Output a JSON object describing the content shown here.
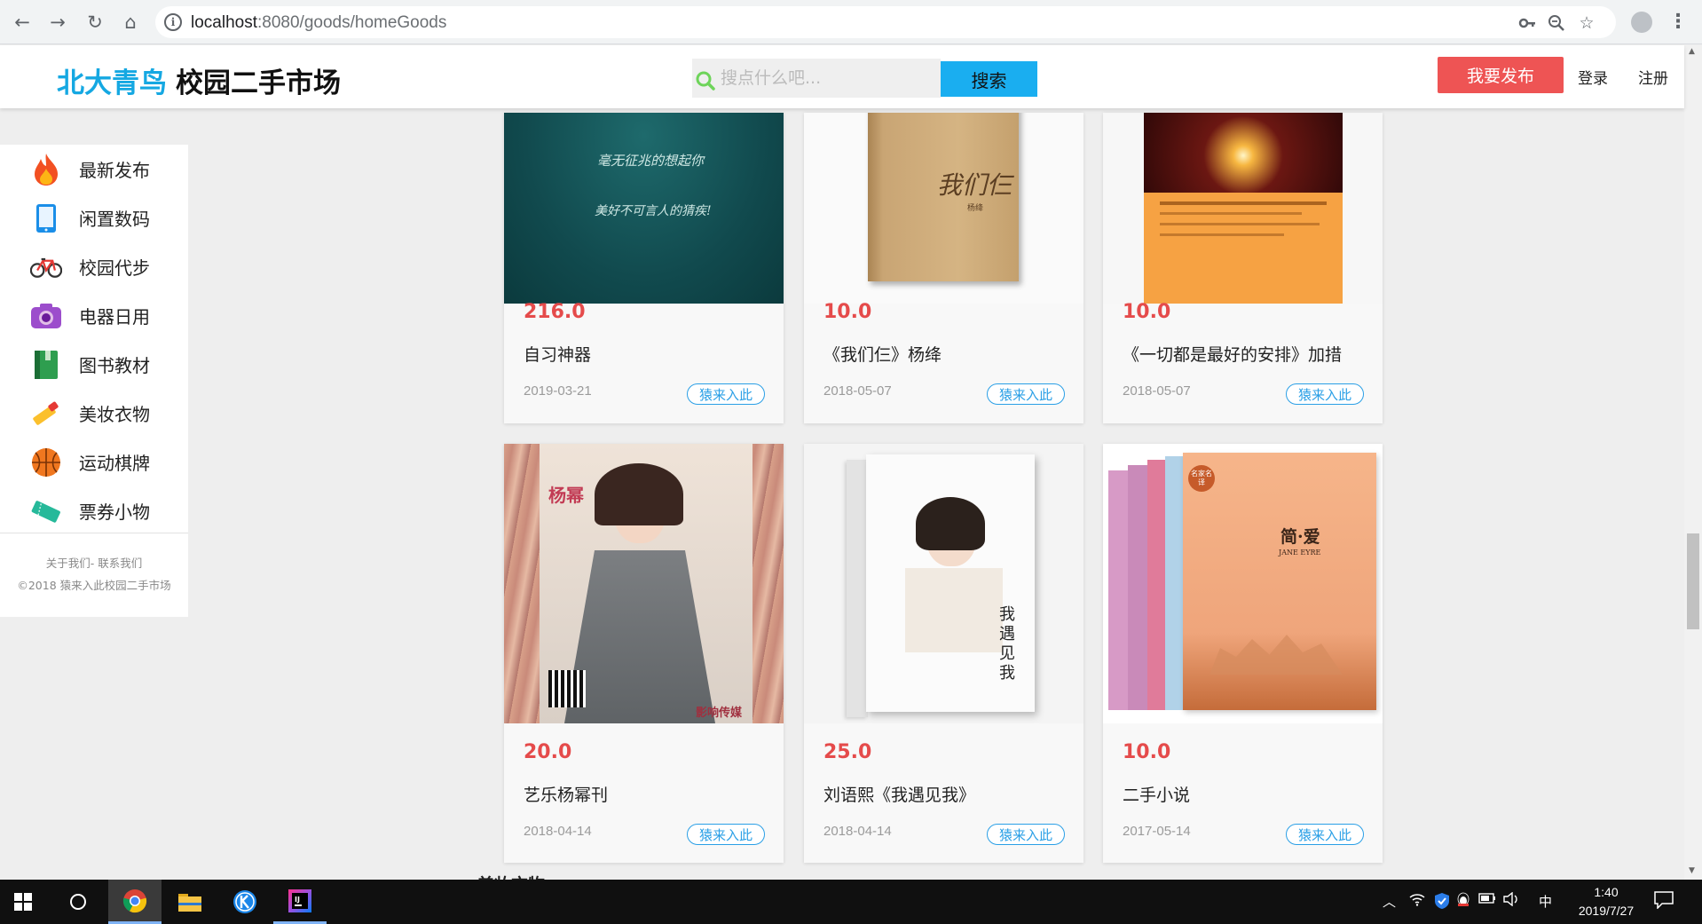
{
  "browser": {
    "url_host": "localhost",
    "url_rest": ":8080/goods/homeGoods"
  },
  "header": {
    "brand_blue": "北大青鸟",
    "brand_black": "校园二手市场",
    "search_placeholder": "搜点什么吧...",
    "search_button": "搜索",
    "publish_button": "我要发布",
    "login": "登录",
    "register": "注册"
  },
  "sidebar": {
    "items": [
      {
        "label": "最新发布",
        "icon": "fire-icon"
      },
      {
        "label": "闲置数码",
        "icon": "phone-icon"
      },
      {
        "label": "校园代步",
        "icon": "bicycle-icon"
      },
      {
        "label": "电器日用",
        "icon": "camera-icon"
      },
      {
        "label": "图书教材",
        "icon": "book-icon"
      },
      {
        "label": "美妆衣物",
        "icon": "lipstick-icon"
      },
      {
        "label": "运动棋牌",
        "icon": "basketball-icon"
      },
      {
        "label": "票券小物",
        "icon": "ticket-icon"
      }
    ],
    "footer_links": "关于我们- 联系我们",
    "copyright": "©2018 猿来入此校园二手市场"
  },
  "goods": [
    {
      "price": "216.0",
      "title": "自习神器",
      "date": "2019-03-21",
      "button": "猿来入此",
      "img_text_1": "毫无征兆的想起你",
      "img_text_2": "美好不可言人的猜疾!"
    },
    {
      "price": "10.0",
      "title": "《我们仨》杨绛",
      "date": "2018-05-07",
      "button": "猿来入此",
      "img_text_1": "我们仨",
      "img_text_2": "杨绛"
    },
    {
      "price": "10.0",
      "title": "《一切都是最好的安排》加措",
      "date": "2018-05-07",
      "button": "猿来入此"
    },
    {
      "price": "20.0",
      "title": "艺乐杨幂刊",
      "date": "2018-04-14",
      "button": "猿来入此",
      "img_text_1": "杨幂",
      "img_text_2": "影响传媒"
    },
    {
      "price": "25.0",
      "title": "刘语熙《我遇见我》",
      "date": "2018-04-14",
      "button": "猿来入此",
      "img_text_1": "我遇见我"
    },
    {
      "price": "10.0",
      "title": "二手小说",
      "date": "2017-05-14",
      "button": "猿来入此",
      "img_text_1": "简·爱",
      "img_text_2": "JANE EYRE",
      "img_text_3": "名家名译"
    }
  ],
  "next_section_heading": "美妆衣物",
  "taskbar": {
    "time": "1:40",
    "date": "2019/7/27",
    "ime": "中"
  }
}
